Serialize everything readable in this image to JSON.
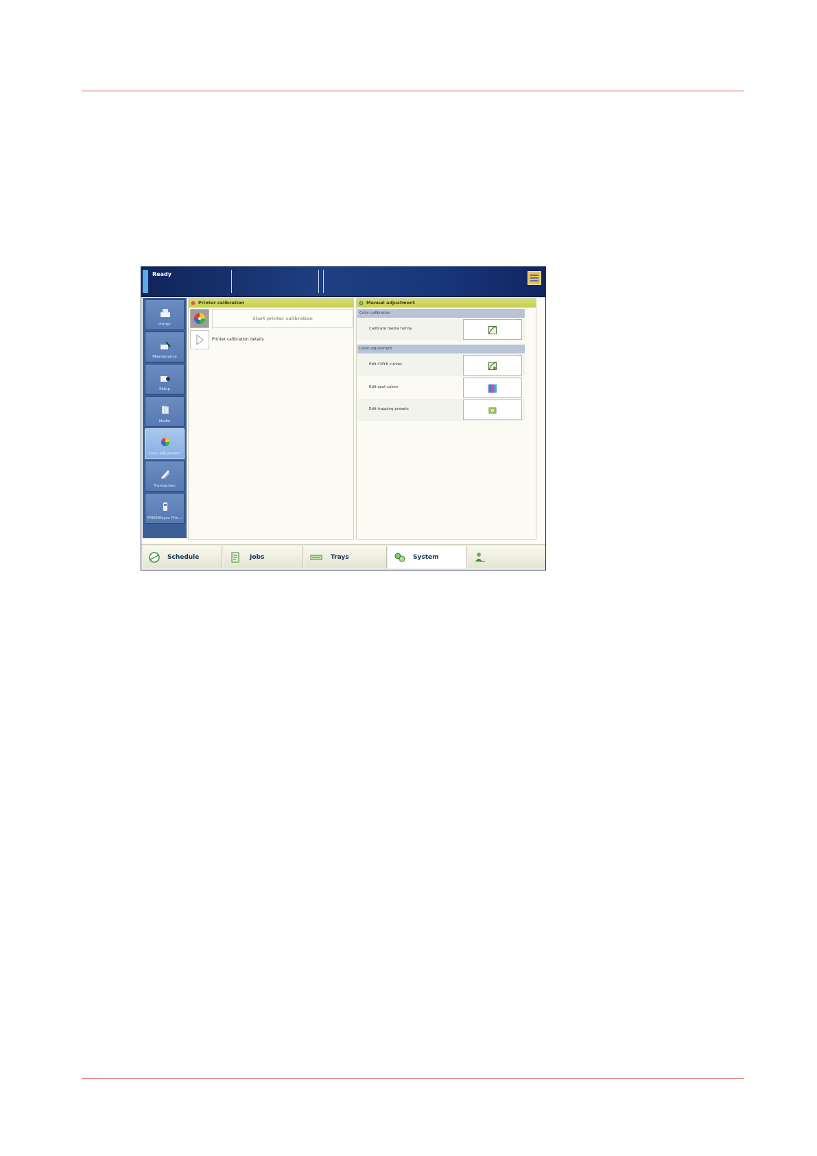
{
  "status": {
    "state": "Ready"
  },
  "sidenav": {
    "items": [
      {
        "label": "Printer",
        "icon": "printer-icon"
      },
      {
        "label": "Maintenance",
        "icon": "maintenance-icon"
      },
      {
        "label": "Setup",
        "icon": "setup-icon"
      },
      {
        "label": "Media",
        "icon": "media-icon"
      },
      {
        "label": "Color adjustment",
        "icon": "color-adjustment-icon",
        "active": true
      },
      {
        "label": "Transaction",
        "icon": "transaction-icon"
      },
      {
        "label": "PRISMAsync Prin...",
        "icon": "prismasync-icon"
      }
    ]
  },
  "printer_calibration": {
    "title": "Printer calibration",
    "start_label": "Start printer calibration",
    "details_label": "Printer calibration details"
  },
  "manual_adjustment": {
    "title": "Manual adjustment",
    "color_calibration": {
      "heading": "Color calibration",
      "items": [
        {
          "label": "Calibrate media family",
          "icon": "curve-icon"
        }
      ]
    },
    "color_adjustment": {
      "heading": "Color adjustment",
      "items": [
        {
          "label": "Edit CMYK curves",
          "icon": "cmyk-curve-icon"
        },
        {
          "label": "Edit spot colors",
          "icon": "spot-colors-icon"
        },
        {
          "label": "Edit trapping presets",
          "icon": "trapping-icon"
        }
      ]
    }
  },
  "tabs": [
    {
      "label": "Schedule",
      "icon": "schedule-icon"
    },
    {
      "label": "Jobs",
      "icon": "jobs-icon"
    },
    {
      "label": "Trays",
      "icon": "trays-icon"
    },
    {
      "label": "System",
      "icon": "system-icon",
      "selected": true
    },
    {
      "label": "",
      "icon": "user-icon"
    }
  ],
  "colors": {
    "accent_bar": "#c5cf4e",
    "status_bg": "#1f3f82",
    "divider": "#d94f4f"
  }
}
